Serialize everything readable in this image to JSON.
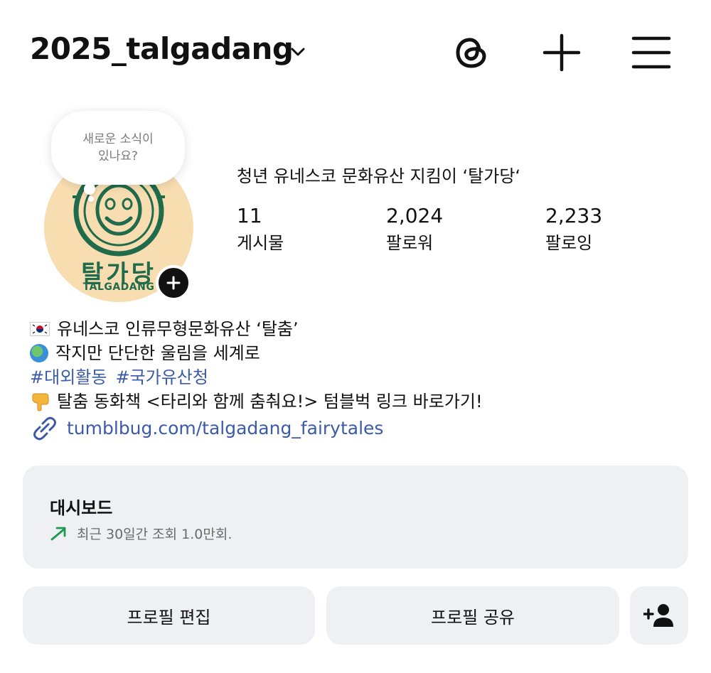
{
  "header": {
    "username": "2025_talgadang",
    "icons": [
      "chevron-down-icon",
      "threads-icon",
      "plus-icon",
      "menu-icon"
    ]
  },
  "note": {
    "line1": "새로운 소식이",
    "line2": "있나요?"
  },
  "avatar": {
    "logo_korean": "탈가당",
    "logo_english": "TALGADANG",
    "colors": {
      "background": "#f7ddb0",
      "logo": "#1f6b4b"
    }
  },
  "profile": {
    "full_name": "청년 유네스코 문화유산 지킴이 ‘탈가당‘",
    "stats": [
      {
        "value": "11",
        "label": "게시물"
      },
      {
        "value": "2,024",
        "label": "팔로워"
      },
      {
        "value": "2,233",
        "label": "팔로잉"
      }
    ]
  },
  "bio": {
    "line1": "유네스코 인류무형문화유산 ‘탈춤’",
    "line2": "작지만 단단한 울림을 세계로",
    "hashtags": [
      "#대외활동",
      "#국가유산청"
    ],
    "line4": "탈춤 동화책 <타리와 함께 춤춰요!> 텀블벅 링크 바로가기!",
    "link": "tumblbug.com/talgadang_fairytales",
    "link_color": "#3b5aa8"
  },
  "dashboard": {
    "title": "대시보드",
    "subtitle": "최근 30일간 조회 1.0만회.",
    "trend_color": "#1a9a52"
  },
  "buttons": {
    "edit_profile": "프로필 편집",
    "share_profile": "프로필 공유"
  }
}
